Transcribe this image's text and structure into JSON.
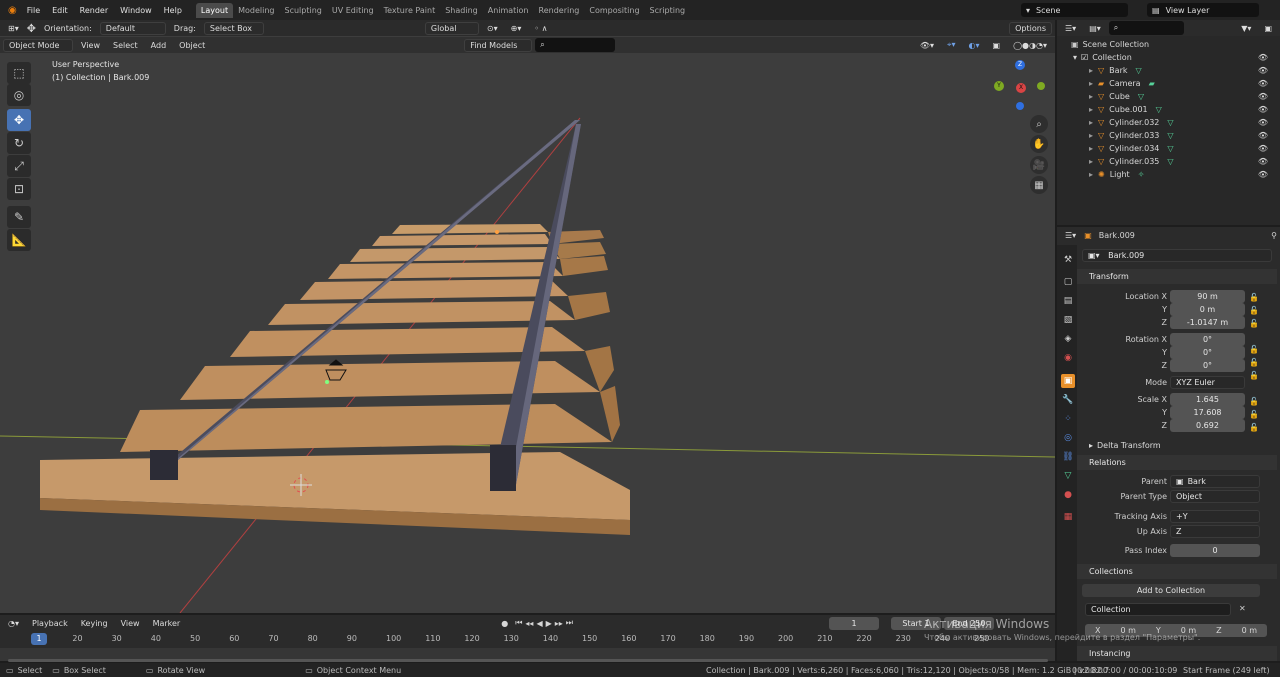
{
  "topbar": {
    "menus": [
      "File",
      "Edit",
      "Render",
      "Window",
      "Help"
    ],
    "workspaces": [
      "Layout",
      "Modeling",
      "Sculpting",
      "UV Editing",
      "Texture Paint",
      "Shading",
      "Animation",
      "Rendering",
      "Compositing",
      "Scripting"
    ],
    "active_workspace": "Layout",
    "scene": "Scene",
    "view_layer": "View Layer"
  },
  "viewport_header": {
    "orientation_label": "Orientation:",
    "orientation_value": "Default",
    "drag_label": "Drag:",
    "drag_value": "Select Box",
    "transform_orientation": "Global",
    "options": "Options",
    "mode": "Object Mode",
    "menus": [
      "View",
      "Select",
      "Add",
      "Object"
    ],
    "find_models": "Find Models"
  },
  "viewport": {
    "perspective": "User Perspective",
    "context": "(1) Collection | Bark.009",
    "gizmo": {
      "z": "Z",
      "y": "Y",
      "x": "X"
    }
  },
  "outliner": {
    "root": "Scene Collection",
    "collection": "Collection",
    "items": [
      "Bark",
      "Camera",
      "Cube",
      "Cube.001",
      "Cylinder.032",
      "Cylinder.033",
      "Cylinder.034",
      "Cylinder.035",
      "Light"
    ]
  },
  "properties": {
    "object_name": "Bark.009",
    "datablock": "Bark.009",
    "transform": {
      "title": "Transform",
      "location_label": "Location X",
      "loc_x": "90 m",
      "loc_y": "0 m",
      "loc_z": "-1.0147 m",
      "rotation_label": "Rotation X",
      "rot_x": "0°",
      "rot_y": "0°",
      "rot_z": "0°",
      "mode_label": "Mode",
      "mode": "XYZ Euler",
      "scale_label": "Scale X",
      "scale_x": "1.645",
      "scale_y": "17.608",
      "scale_z": "0.692",
      "y": "Y",
      "z": "Z"
    },
    "delta": "Delta Transform",
    "relations": {
      "title": "Relations",
      "parent_label": "Parent",
      "parent": "Bark",
      "parent_type_label": "Parent Type",
      "parent_type": "Object",
      "tracking_label": "Tracking Axis",
      "tracking": "+Y",
      "up_label": "Up Axis",
      "up": "Z",
      "pass_label": "Pass Index",
      "pass": "0"
    },
    "collections": {
      "title": "Collections",
      "add": "Add to Collection",
      "name": "Collection",
      "x_label": "X",
      "x": "0 m",
      "y_label": "Y",
      "y": "0 m",
      "z_label": "Z",
      "z": "0 m"
    },
    "instancing": "Instancing"
  },
  "timeline": {
    "menus": [
      "Playback",
      "Keying",
      "View",
      "Marker"
    ],
    "current_frame": "1",
    "start_label": "Start",
    "start": "1",
    "end_label": "End",
    "end": "250",
    "ticks": [
      "1",
      "10",
      "20",
      "30",
      "40",
      "50",
      "60",
      "70",
      "80",
      "90",
      "100",
      "110",
      "120",
      "130",
      "140",
      "150",
      "160",
      "170",
      "180",
      "190",
      "200",
      "210",
      "220",
      "230",
      "240",
      "250"
    ]
  },
  "watermark": {
    "line1": "Активация Windows",
    "line2": "Чтобы активировать Windows, перейдите в раздел \"Параметры\"."
  },
  "statusbar": {
    "select": "Select",
    "box_select": "Box Select",
    "rotate_view": "Rotate View",
    "context_menu": "Object Context Menu",
    "stats": "Collection | Bark.009 | Verts:6,260 | Faces:6,060 | Tris:12,120 | Objects:0/58 | Mem: 1.2 GiB | v2.82.7",
    "time": "00:00:00:00 / 00:00:10:09",
    "start_frame": "Start Frame (249 left)"
  },
  "colors": {
    "accent": "#4772b3",
    "wood": "#c69a68",
    "rail": "#4a4a5a"
  }
}
